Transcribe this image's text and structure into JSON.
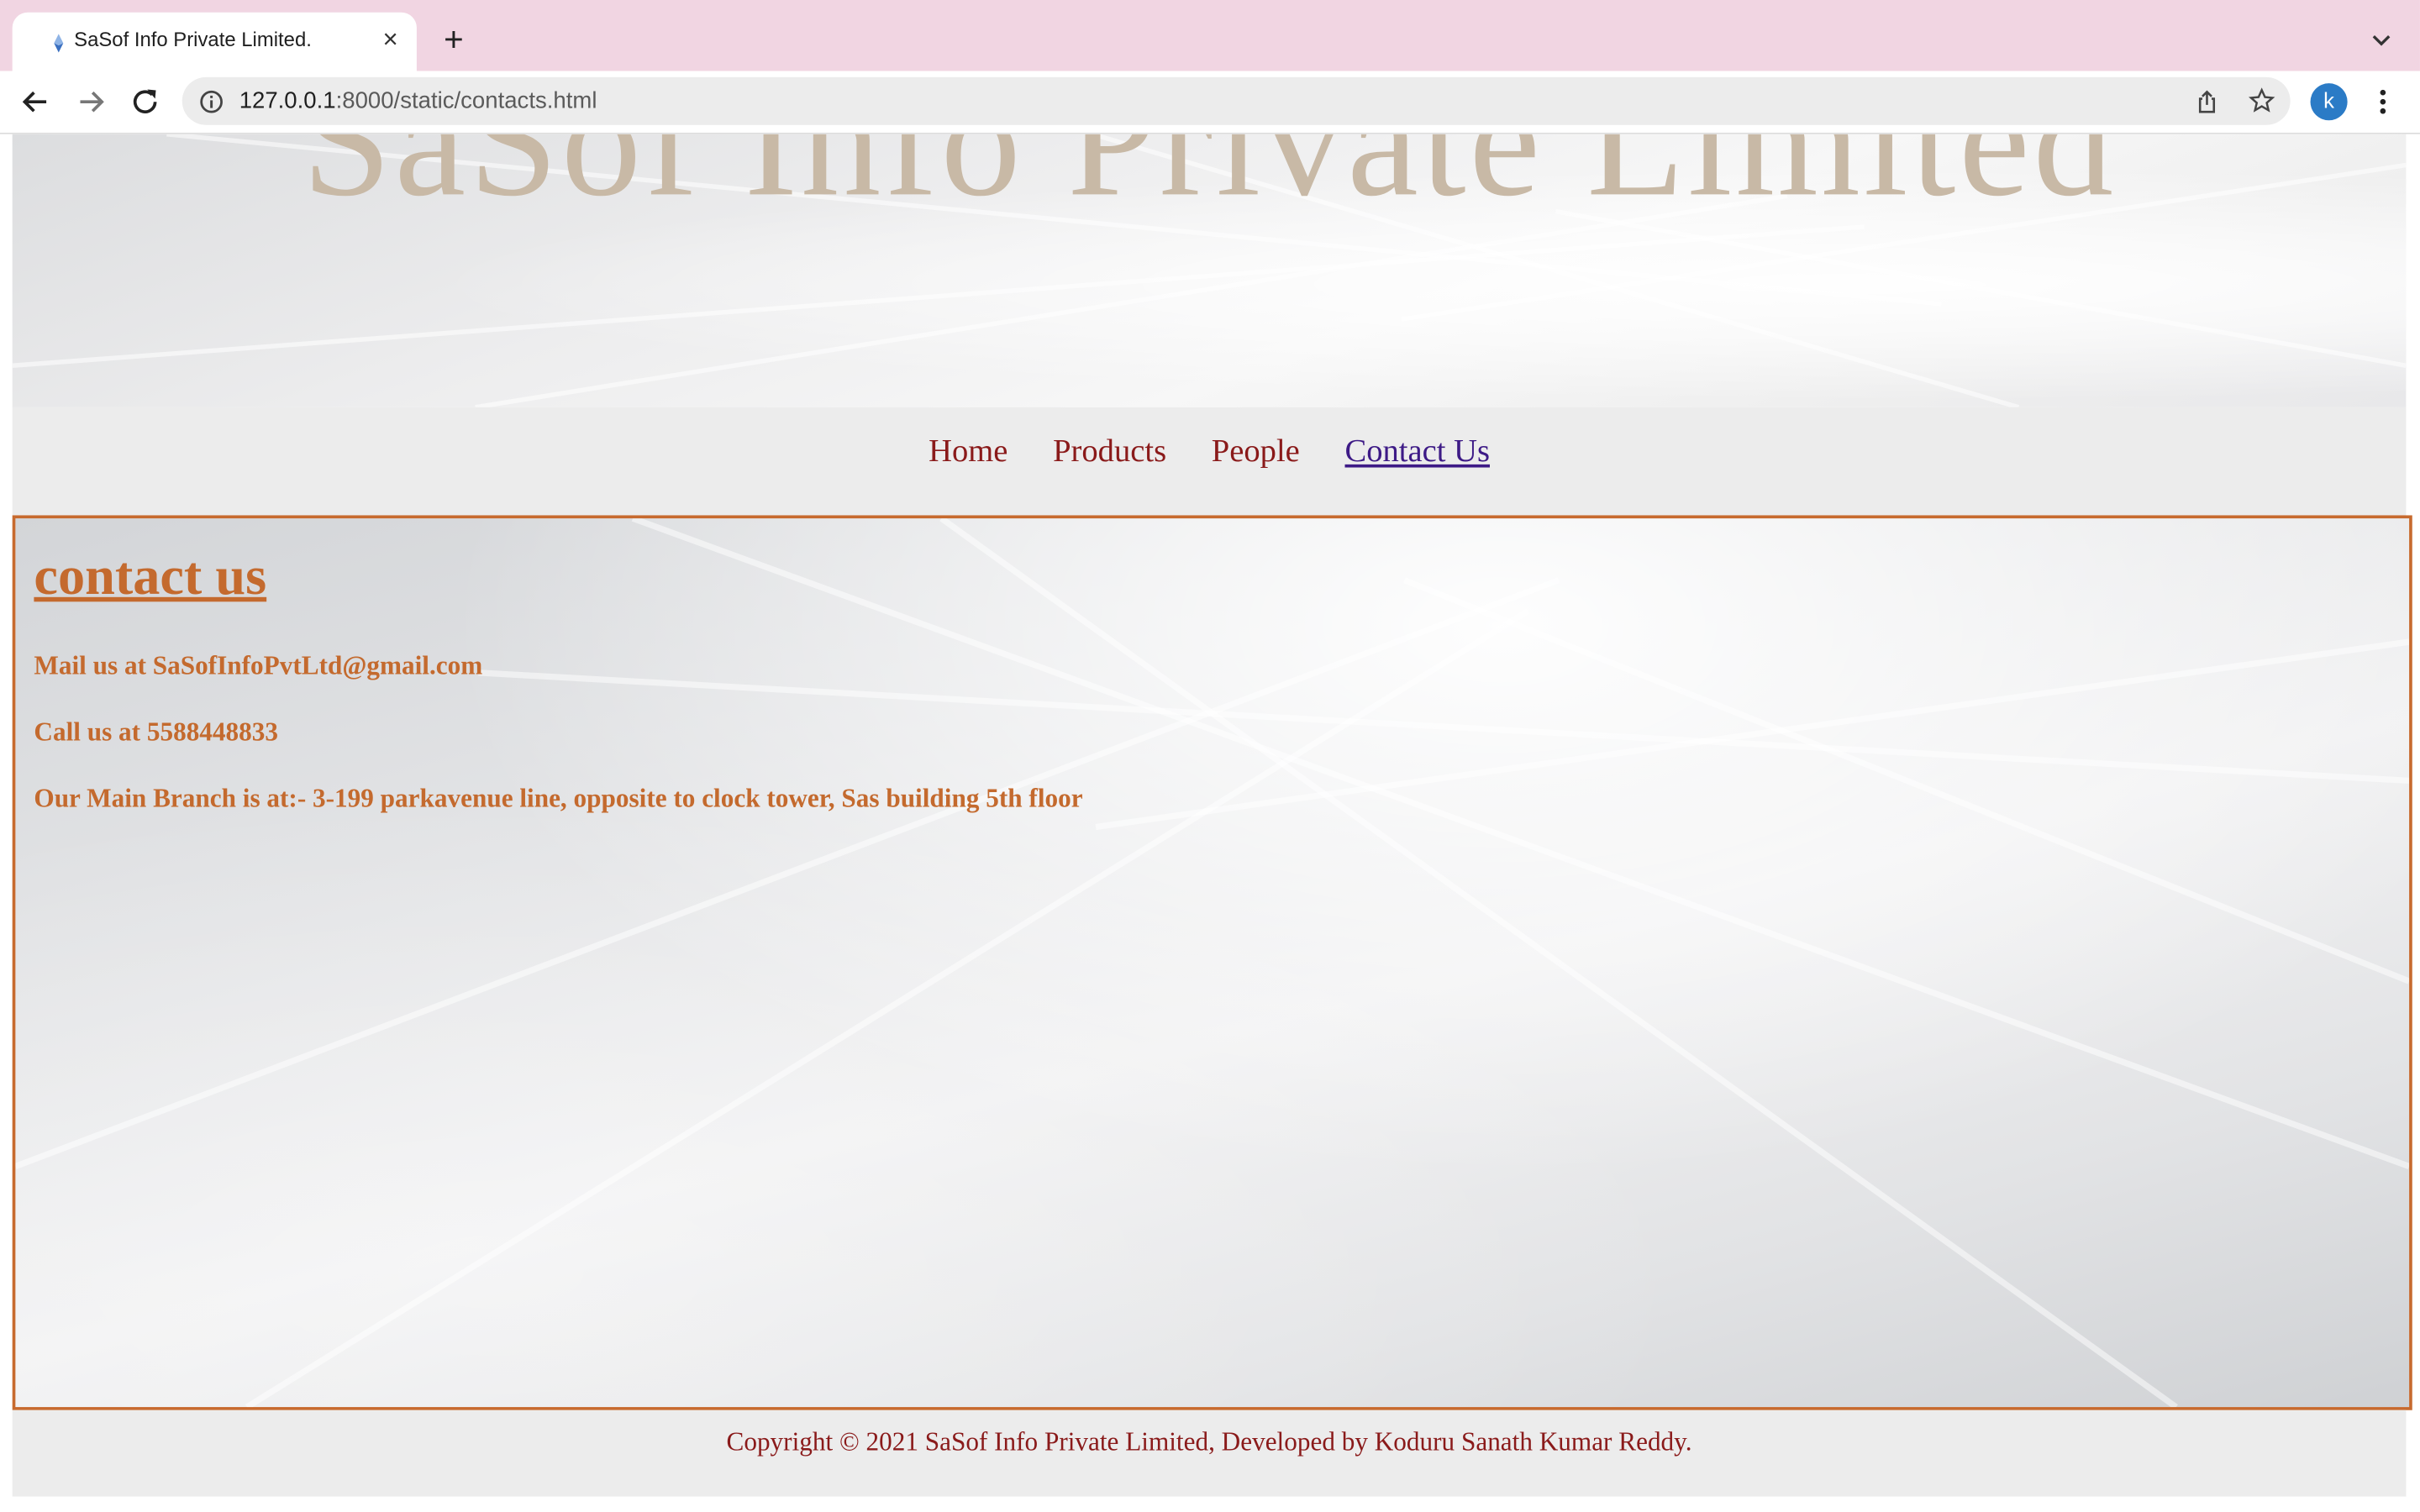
{
  "browser": {
    "tab": {
      "title": "SaSof Info Private Limited.",
      "close_glyph": "×",
      "favicon_icon": "site-favicon-icon"
    },
    "new_tab_glyph": "+",
    "address_bar": {
      "url_host": "127.0.0.1",
      "url_rest": ":8000/static/contacts.html"
    },
    "profile_initial": "k",
    "icons": [
      "back-arrow-icon",
      "forward-arrow-icon",
      "reload-icon",
      "info-icon",
      "share-icon",
      "bookmark-star-icon",
      "kebab-menu-icon",
      "tab-search-chevron-icon"
    ],
    "colors": {
      "tabstrip": "#f1d5e2",
      "avatar": "#2b7bc6"
    }
  },
  "site": {
    "title": "SaSof Info Private Limited",
    "colors": {
      "title": "#c8b9a6",
      "nav_link": "#8a1a1a",
      "nav_active": "#3d1a86",
      "accent": "#c46a2e",
      "border": "#c76a2e"
    }
  },
  "nav": {
    "items": [
      {
        "label": "Home"
      },
      {
        "label": "Products"
      },
      {
        "label": "People"
      },
      {
        "label": "Contact Us",
        "active": true
      }
    ]
  },
  "contact": {
    "heading": "contact us",
    "mail": "Mail us at SaSofInfoPvtLtd@gmail.com",
    "call": "Call us at 5588448833",
    "branch": "Our Main Branch is at:- 3-199 parkavenue line, opposite to clock tower, Sas building 5th floor"
  },
  "footer": {
    "text": "Copyright © 2021 SaSof Info Private Limited, Developed by Koduru Sanath Kumar Reddy."
  }
}
